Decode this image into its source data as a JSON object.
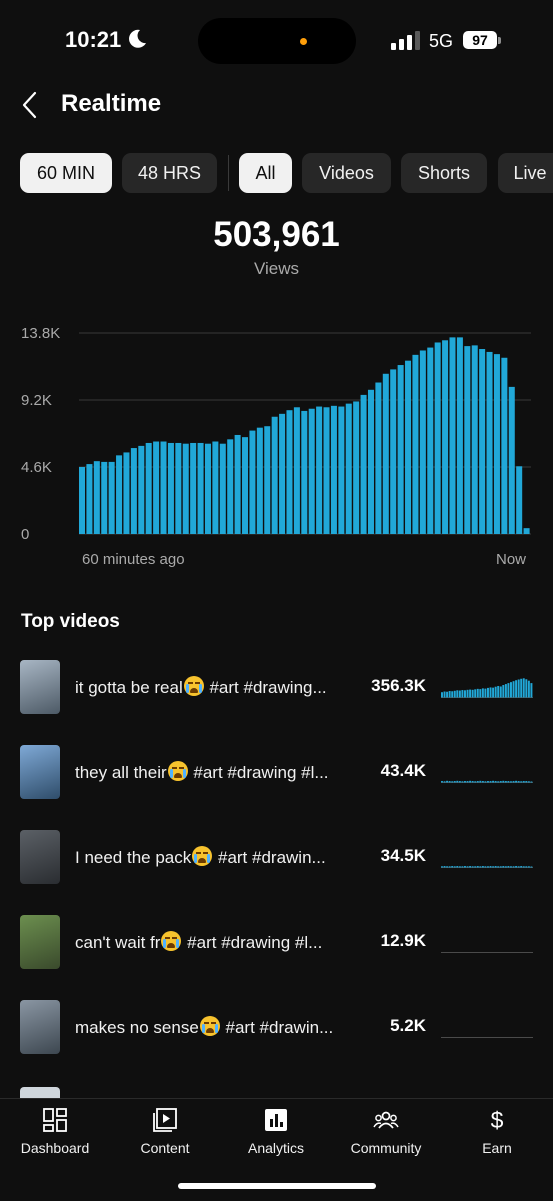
{
  "status_bar": {
    "time": "10:21",
    "network": "5G",
    "battery": "97"
  },
  "header": {
    "title": "Realtime"
  },
  "range_chips": [
    {
      "label": "60 MIN",
      "active": true
    },
    {
      "label": "48 HRS",
      "active": false
    }
  ],
  "type_chips": [
    {
      "label": "All",
      "active": true
    },
    {
      "label": "Videos",
      "active": false
    },
    {
      "label": "Shorts",
      "active": false
    },
    {
      "label": "Live",
      "active": false
    }
  ],
  "summary": {
    "total": "503,961",
    "label": "Views"
  },
  "chart_data": {
    "type": "bar",
    "y_tick_labels": [
      "0",
      "4.6K",
      "9.2K",
      "13.8K"
    ],
    "y_ticks": [
      0,
      4600,
      9200,
      13800
    ],
    "ylim": [
      0,
      13800
    ],
    "x_tick_labels": [
      "60 minutes ago",
      "Now"
    ],
    "x_range_minutes": [
      -60,
      0
    ],
    "grid": true,
    "color": "#21a8d8",
    "values": [
      4600,
      4800,
      5000,
      4950,
      4950,
      5400,
      5600,
      5900,
      6050,
      6250,
      6350,
      6350,
      6250,
      6250,
      6200,
      6250,
      6250,
      6200,
      6350,
      6200,
      6500,
      6800,
      6650,
      7100,
      7300,
      7400,
      8050,
      8250,
      8500,
      8700,
      8450,
      8600,
      8750,
      8700,
      8800,
      8750,
      8950,
      9100,
      9550,
      9900,
      10400,
      11000,
      11300,
      11600,
      11900,
      12300,
      12600,
      12800,
      13150,
      13300,
      13500,
      13500,
      12900,
      12950,
      12700,
      12500,
      12350,
      12100,
      10100,
      4650,
      400
    ]
  },
  "top_videos": {
    "title": "Top videos",
    "items": [
      {
        "title": "it gotta be real",
        "tags": " #art #drawing...",
        "views": "356.3K",
        "thumb_colors": [
          "#a8b6c4",
          "#4d5a66"
        ],
        "spark": [
          0.22,
          0.25,
          0.24,
          0.27,
          0.26,
          0.28,
          0.3,
          0.29,
          0.31,
          0.3,
          0.32,
          0.33,
          0.32,
          0.34,
          0.36,
          0.35,
          0.38,
          0.37,
          0.4,
          0.42,
          0.41,
          0.45,
          0.48,
          0.46,
          0.52,
          0.56,
          0.6,
          0.64,
          0.68,
          0.72,
          0.75,
          0.78,
          0.8,
          0.76,
          0.7,
          0.6
        ]
      },
      {
        "title": "they all their",
        "tags": " #art #drawing #l...",
        "views": "43.4K",
        "thumb_colors": [
          "#7fa9d6",
          "#2f4d6a"
        ],
        "spark": [
          0.06,
          0.05,
          0.07,
          0.06,
          0.05,
          0.06,
          0.07,
          0.06,
          0.05,
          0.06,
          0.06,
          0.07,
          0.06,
          0.05,
          0.06,
          0.07,
          0.06,
          0.05,
          0.06,
          0.06,
          0.07,
          0.06,
          0.05,
          0.06,
          0.07,
          0.06,
          0.06,
          0.05,
          0.06,
          0.07,
          0.06,
          0.05,
          0.06,
          0.06,
          0.05,
          0.04
        ]
      },
      {
        "title": "I need the pack",
        "tags": " #art #drawin...",
        "views": "34.5K",
        "thumb_colors": [
          "#5b6066",
          "#2a2d31"
        ],
        "spark": [
          0.05,
          0.06,
          0.05,
          0.05,
          0.06,
          0.05,
          0.06,
          0.05,
          0.05,
          0.06,
          0.05,
          0.06,
          0.05,
          0.05,
          0.06,
          0.05,
          0.06,
          0.05,
          0.05,
          0.06,
          0.05,
          0.06,
          0.05,
          0.05,
          0.06,
          0.05,
          0.06,
          0.05,
          0.05,
          0.06,
          0.05,
          0.06,
          0.05,
          0.05,
          0.05,
          0.04
        ]
      },
      {
        "title": "can't wait fr",
        "tags": " #art #drawing #l...",
        "views": "12.9K",
        "thumb_colors": [
          "#6c8f4f",
          "#3a4a2c"
        ],
        "spark": []
      },
      {
        "title": "makes no sense",
        "tags": " #art #drawin...",
        "views": "5.2K",
        "thumb_colors": [
          "#8a96a3",
          "#3d4750"
        ],
        "spark": []
      }
    ]
  },
  "bottom_nav": [
    {
      "label": "Dashboard",
      "icon": "dashboard-icon"
    },
    {
      "label": "Content",
      "icon": "content-icon"
    },
    {
      "label": "Analytics",
      "icon": "analytics-icon"
    },
    {
      "label": "Community",
      "icon": "community-icon"
    },
    {
      "label": "Earn",
      "icon": "earn-icon"
    }
  ]
}
